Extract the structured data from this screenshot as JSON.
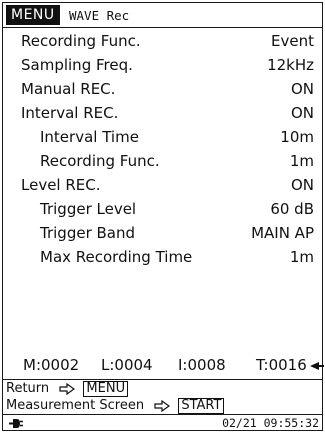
{
  "header": {
    "menu_label": "MENU",
    "mode_label": "WAVE Rec"
  },
  "settings": [
    {
      "label": "Recording Func.",
      "value": "Event",
      "indent": false
    },
    {
      "label": "Sampling Freq.",
      "value": "12kHz",
      "indent": false
    },
    {
      "label": "Manual REC.",
      "value": "ON",
      "indent": false
    },
    {
      "label": "Interval REC.",
      "value": "ON",
      "indent": false
    },
    {
      "label": "Interval Time",
      "value": "10m",
      "indent": true
    },
    {
      "label": "Recording Func.",
      "value": "1m",
      "indent": true
    },
    {
      "label": "Level REC.",
      "value": "ON",
      "indent": false
    },
    {
      "label": "Trigger Level",
      "value": "60 dB",
      "indent": true
    },
    {
      "label": "Trigger Band",
      "value": "MAIN AP",
      "indent": true
    },
    {
      "label": "Max Recording Time",
      "value": "1m",
      "indent": true
    }
  ],
  "counters": {
    "m": "M:0002",
    "l": "L:0004",
    "i": "I:0008",
    "t": "T:0016"
  },
  "footer": {
    "return_text": "Return",
    "menu_key": "MENU",
    "measurement_text": "Measurement Screen",
    "start_key": "START"
  },
  "status": {
    "datetime": "02/21 09:55:32",
    "power_icon": "ac-plug-icon"
  },
  "icons": {
    "hollow_arrow": "hollow-right-arrow-icon",
    "scroll_indicator": "arrow-left-icon"
  },
  "colors": {
    "foreground": "#111111",
    "background": "#ffffff",
    "badge_bg": "#111111",
    "badge_fg": "#ffffff"
  }
}
